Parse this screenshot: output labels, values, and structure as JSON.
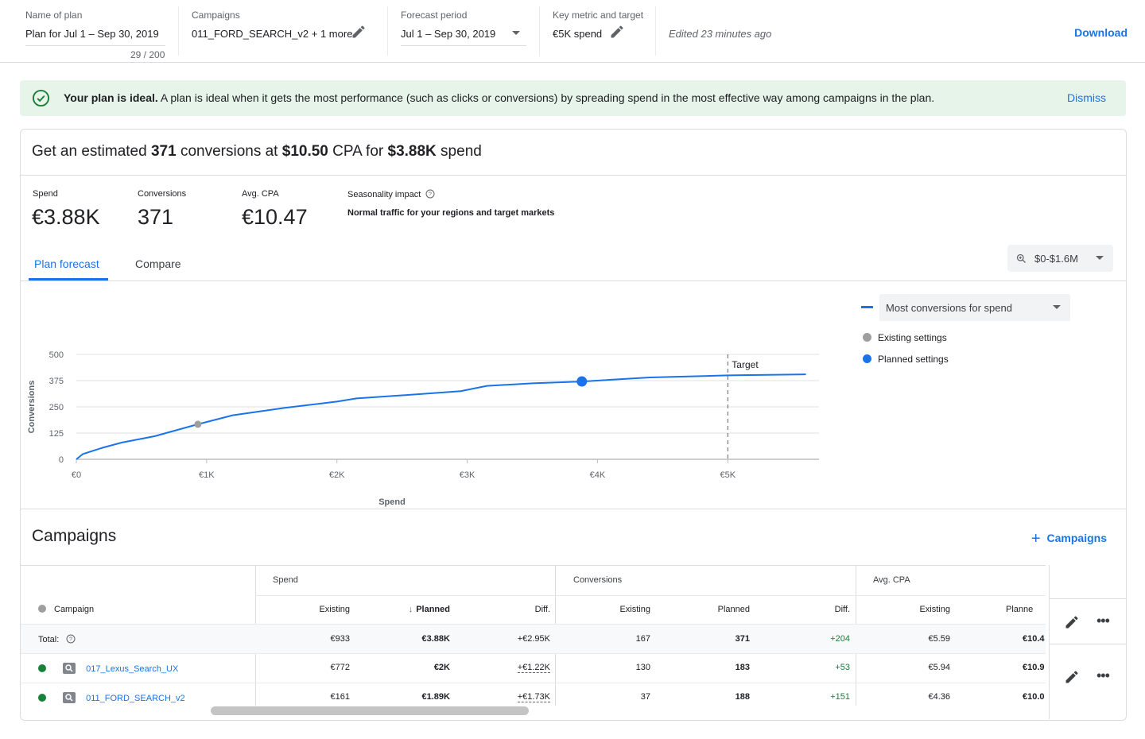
{
  "header": {
    "name_label": "Name of plan",
    "name_value": "Plan for Jul 1 – Sep 30, 2019",
    "name_counter": "29 / 200",
    "campaigns_label": "Campaigns",
    "campaigns_value": "011_FORD_SEARCH_v2 + 1 more",
    "forecast_label": "Forecast period",
    "forecast_value": "Jul 1 – Sep 30, 2019",
    "metric_label": "Key metric and target",
    "metric_value": "€5K spend",
    "edited": "Edited 23 minutes ago",
    "download": "Download"
  },
  "banner": {
    "bold": "Your plan is ideal.",
    "text": " A plan is ideal when it gets the most performance (such as clicks or conversions) by spreading spend in the most effective way among campaigns in the plan.",
    "dismiss": "Dismiss"
  },
  "summary": {
    "p1": "Get an estimated ",
    "conv": "371",
    "p2": " conversions at ",
    "cpa": "$10.50",
    "p3": " CPA for ",
    "spend": "$3.88K",
    "p4": " spend"
  },
  "stats": {
    "spend_label": "Spend",
    "spend_value": "€3.88K",
    "conv_label": "Conversions",
    "conv_value": "371",
    "cpa_label": "Avg. CPA",
    "cpa_value": "€10.47",
    "season_label": "Seasonality impact",
    "season_text": "Normal traffic for your regions and target markets"
  },
  "tabs": {
    "forecast": "Plan forecast",
    "compare": "Compare"
  },
  "range": "$0-$1.6M",
  "strategy": "Most conversions for spend",
  "legend": {
    "existing": "Existing settings",
    "planned": "Planned settings"
  },
  "colors": {
    "accent": "#1a73e8",
    "existing": "#9e9e9e",
    "positive": "#188038",
    "banner": "#e6f4ea"
  },
  "chart_data": {
    "type": "line",
    "xlabel": "Spend",
    "ylabel": "Conversions",
    "x_ticks": [
      "€0",
      "€1K",
      "€2K",
      "€3K",
      "€4K",
      "€5K"
    ],
    "y_ticks": [
      "500",
      "375",
      "250",
      "125",
      "0"
    ],
    "xlim": [
      0,
      5700
    ],
    "ylim": [
      0,
      500
    ],
    "series": [
      {
        "values": [
          [
            0,
            0
          ],
          [
            50,
            25
          ],
          [
            200,
            55
          ],
          [
            350,
            80
          ],
          [
            600,
            110
          ],
          [
            933,
            167
          ],
          [
            1200,
            210
          ],
          [
            1600,
            245
          ],
          [
            2000,
            275
          ],
          [
            2150,
            290
          ],
          [
            2500,
            305
          ],
          [
            2950,
            325
          ],
          [
            3150,
            350
          ],
          [
            3500,
            362
          ],
          [
            3880,
            371
          ],
          [
            4400,
            390
          ],
          [
            5000,
            400
          ],
          [
            5600,
            405
          ]
        ]
      }
    ],
    "points": {
      "existing": [
        933,
        167
      ],
      "planned": [
        3880,
        371
      ]
    },
    "target": {
      "label": "Target",
      "x": 5000
    },
    "grid": true
  },
  "campaigns": {
    "title": "Campaigns",
    "add_label": "Campaigns",
    "groups": {
      "spend": "Spend",
      "conversions": "Conversions",
      "cpa": "Avg. CPA"
    },
    "cols": {
      "campaign": "Campaign",
      "existing": "Existing",
      "planned": "Planned",
      "diff": "Diff.",
      "planned_cut": "Planne"
    },
    "total_label": "Total:",
    "total": [
      "€933",
      "€3.88K",
      "+€2.95K",
      "167",
      "371",
      "+204",
      "€5.59",
      "€10.4"
    ],
    "rows": [
      {
        "name": "017_Lexus_Search_UX",
        "values": [
          "€772",
          "€2K",
          "+€1.22K",
          "130",
          "183",
          "+53",
          "€5.94",
          "€10.9"
        ]
      },
      {
        "name": "011_FORD_SEARCH_v2",
        "values": [
          "€161",
          "€1.89K",
          "+€1.73K",
          "37",
          "188",
          "+151",
          "€4.36",
          "€10.0"
        ]
      }
    ]
  }
}
